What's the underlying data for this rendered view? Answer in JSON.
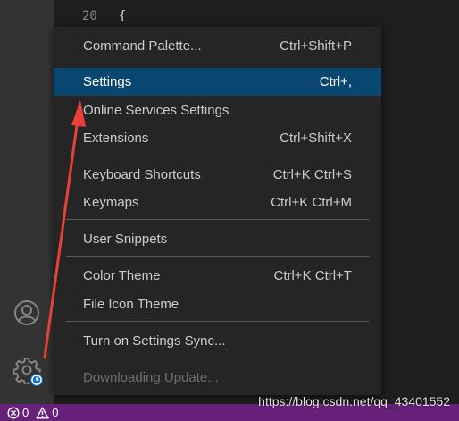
{
  "editor": {
    "line_number": "20",
    "line_text": "{"
  },
  "menu": {
    "items": [
      {
        "label": "Command Palette...",
        "shortcut": "Ctrl+Shift+P"
      },
      {
        "label": "Settings",
        "shortcut": "Ctrl+,",
        "selected": true
      },
      {
        "label": "Online Services Settings",
        "shortcut": ""
      },
      {
        "label": "Extensions",
        "shortcut": "Ctrl+Shift+X"
      },
      {
        "label": "Keyboard Shortcuts",
        "shortcut": "Ctrl+K Ctrl+S"
      },
      {
        "label": "Keymaps",
        "shortcut": "Ctrl+K Ctrl+M"
      },
      {
        "label": "User Snippets",
        "shortcut": ""
      },
      {
        "label": "Color Theme",
        "shortcut": "Ctrl+K Ctrl+T"
      },
      {
        "label": "File Icon Theme",
        "shortcut": ""
      },
      {
        "label": "Turn on Settings Sync...",
        "shortcut": ""
      },
      {
        "label": "Downloading Update...",
        "shortcut": "",
        "disabled": true
      }
    ]
  },
  "activity_bar": {
    "icons": [
      "account-icon",
      "manage-gear-icon"
    ]
  },
  "status_bar": {
    "errors": "0",
    "warnings": "0"
  },
  "watermark": "https://blog.csdn.net/qq_43401552",
  "colors": {
    "status_bar": "#68217a",
    "menu_selected": "#094771",
    "menu_bg": "#252526",
    "annotation_arrow": "#e8413a"
  }
}
